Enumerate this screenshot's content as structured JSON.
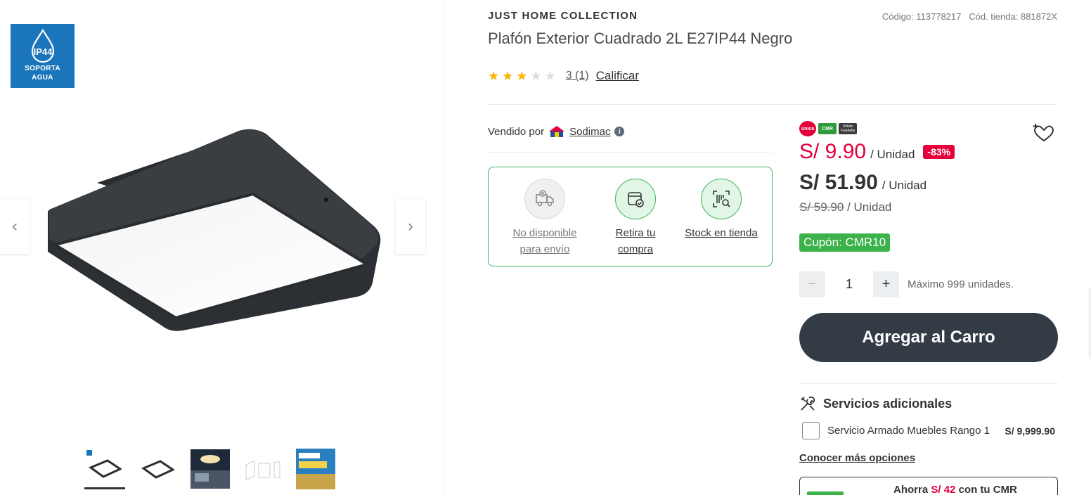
{
  "badge": {
    "line1": "SOPORTA",
    "line2": "AGUA",
    "ip_label": "IP44"
  },
  "product": {
    "brand": "JUST HOME COLLECTION",
    "title": "Plafón Exterior Cuadrado 2L E27IP44 Negro",
    "code": "Código: 113778217",
    "store_code": "Cód. tienda: 881872X",
    "rating_value": 3,
    "rating_max": 5,
    "rating_text": "3 (1)",
    "rate_link": "Calificar"
  },
  "seller": {
    "prefix": "Vendido por",
    "name": "Sodimac",
    "info": "i"
  },
  "delivery": [
    {
      "label1": "No disponible",
      "label2": "para envío",
      "state": "unavailable",
      "icon": "truck-icon"
    },
    {
      "label1": "Retira tu",
      "label2": "compra",
      "state": "available",
      "icon": "store-pickup-icon"
    },
    {
      "label1": "Stock en tienda",
      "label2": "",
      "state": "available",
      "icon": "barcode-search-icon"
    }
  ],
  "payment_badges": {
    "unica": "única",
    "cmr": "CMR",
    "debit": "Débito Falabella"
  },
  "prices": {
    "cmr_price": "S/ 9.90",
    "cmr_unit": "/ Unidad",
    "discount": "-83%",
    "internet_price": "S/ 51.90",
    "internet_unit": "/ Unidad",
    "normal_price": "S/ 59.90",
    "normal_unit": "/ Unidad"
  },
  "coupon": "Cupón: CMR10",
  "quantity": {
    "minus": "−",
    "value": "1",
    "plus": "+",
    "max_text": "Máximo 999 unidades."
  },
  "cart_button": "Agregar al Carro",
  "services": {
    "title": "Servicios adicionales",
    "item_name": "Servicio Armado Muebles Rango 1",
    "item_price": "S/ 9,999.90",
    "more_link": "Conocer más opciones"
  },
  "cmr_savings": {
    "prefix": "Ahorra",
    "amount": "S/ 42",
    "suffix": "con tu CMR"
  },
  "colors": {
    "accent_red": "#e4003b",
    "cmr_green": "#3cb24a",
    "button_dark": "#333c45",
    "delivery_border": "#3cb65a"
  }
}
